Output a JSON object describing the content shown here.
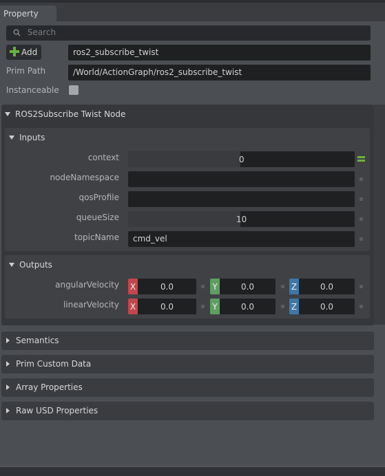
{
  "tab": {
    "label": "Property"
  },
  "search": {
    "placeholder": "Search"
  },
  "toolbar": {
    "add_label": "Add"
  },
  "prim": {
    "name": "ros2_subscribe_twist",
    "path_label": "Prim Path",
    "path": "/World/ActionGraph/ros2_subscribe_twist",
    "instanceable_label": "Instanceable",
    "instanceable": false
  },
  "node": {
    "title": "ROS2Subscribe Twist Node",
    "inputs": {
      "title": "Inputs",
      "context": {
        "label": "context",
        "value": "0"
      },
      "nodeNamespace": {
        "label": "nodeNamespace",
        "value": ""
      },
      "qosProfile": {
        "label": "qosProfile",
        "value": ""
      },
      "queueSize": {
        "label": "queueSize",
        "value": "10"
      },
      "topicName": {
        "label": "topicName",
        "value": "cmd_vel"
      }
    },
    "outputs": {
      "title": "Outputs",
      "angularVelocity": {
        "label": "angularVelocity",
        "x": "0.0",
        "y": "0.0",
        "z": "0.0"
      },
      "linearVelocity": {
        "label": "linearVelocity",
        "x": "0.0",
        "y": "0.0",
        "z": "0.0"
      }
    }
  },
  "axes": {
    "x": "X",
    "y": "Y",
    "z": "Z"
  },
  "sections": {
    "semantics": "Semantics",
    "prim_custom_data": "Prim Custom Data",
    "array_properties": "Array Properties",
    "raw_usd": "Raw USD Properties"
  },
  "colors": {
    "axis_x": "#c4464c",
    "axis_y": "#5f9e63",
    "axis_z": "#3d78a8",
    "add_plus": "#66b23d",
    "connected_marker": "#6fb13f"
  },
  "icons": {
    "search": "search-icon",
    "add": "plus-icon"
  }
}
